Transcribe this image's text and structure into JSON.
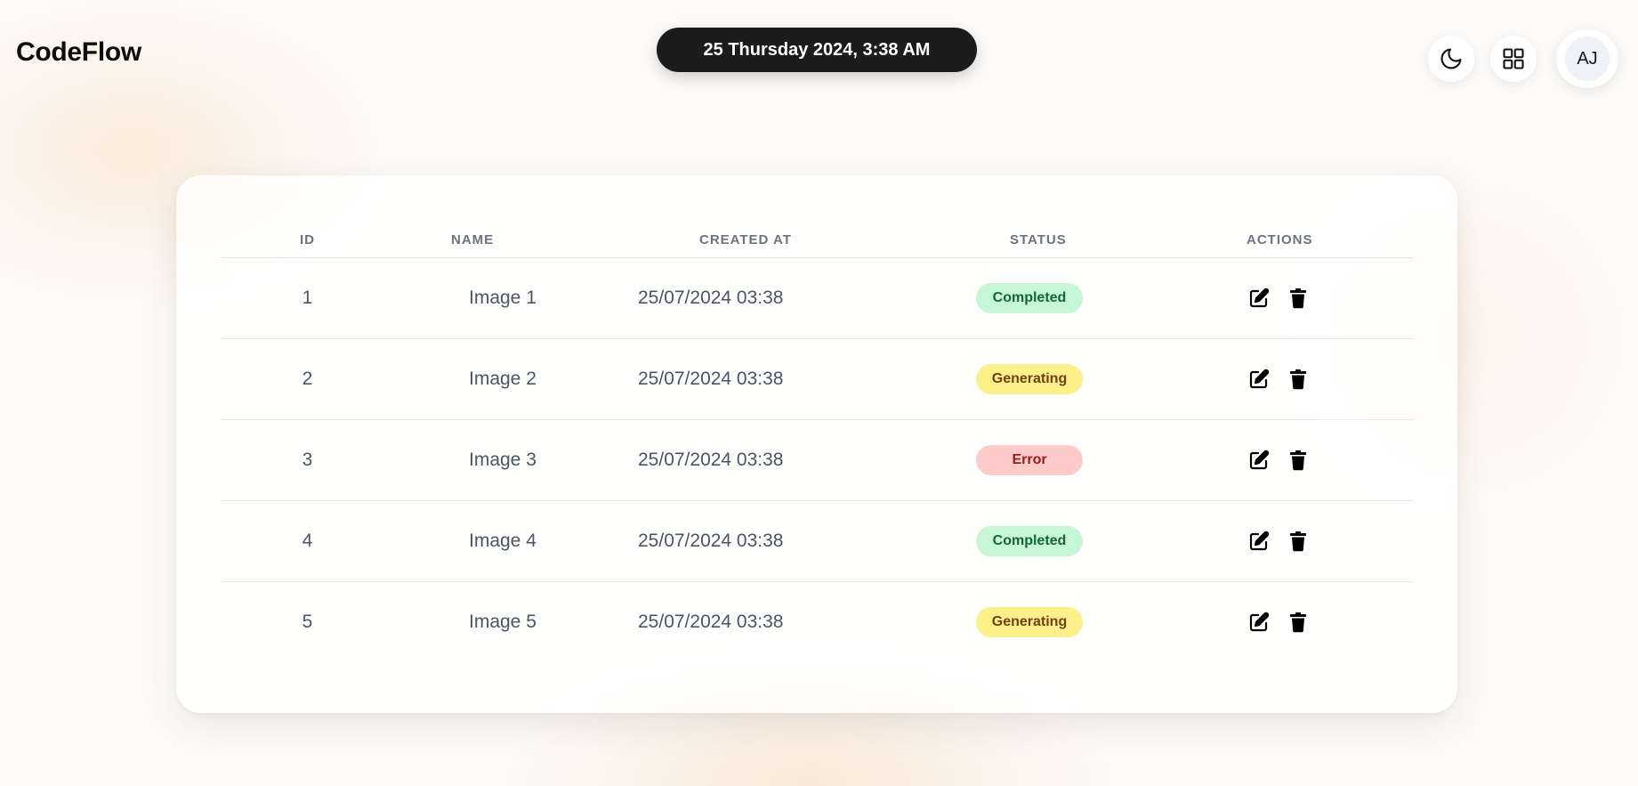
{
  "header": {
    "brand": "CodeFlow",
    "datetime": "25 Thursday 2024, 3:38 AM",
    "theme_toggle_icon": "moon-icon",
    "apps_icon": "grid-icon",
    "avatar_initials": "AJ"
  },
  "table": {
    "columns": [
      "ID",
      "NAME",
      "CREATED AT",
      "STATUS",
      "ACTIONS"
    ],
    "rows": [
      {
        "id": "1",
        "name": "Image 1",
        "created_at": "25/07/2024 03:38",
        "status": "Completed",
        "status_bg": "#c6f6d5",
        "status_fg": "#166534"
      },
      {
        "id": "2",
        "name": "Image 2",
        "created_at": "25/07/2024 03:38",
        "status": "Generating",
        "status_bg": "#fdf08a",
        "status_fg": "#713f12"
      },
      {
        "id": "3",
        "name": "Image 3",
        "created_at": "25/07/2024 03:38",
        "status": "Error",
        "status_bg": "#fecaca",
        "status_fg": "#991b1b"
      },
      {
        "id": "4",
        "name": "Image 4",
        "created_at": "25/07/2024 03:38",
        "status": "Completed",
        "status_bg": "#c6f6d5",
        "status_fg": "#166534"
      },
      {
        "id": "5",
        "name": "Image 5",
        "created_at": "25/07/2024 03:38",
        "status": "Generating",
        "status_bg": "#fdf08a",
        "status_fg": "#713f12"
      }
    ],
    "action_icons": [
      "edit-icon",
      "trash-icon"
    ]
  }
}
